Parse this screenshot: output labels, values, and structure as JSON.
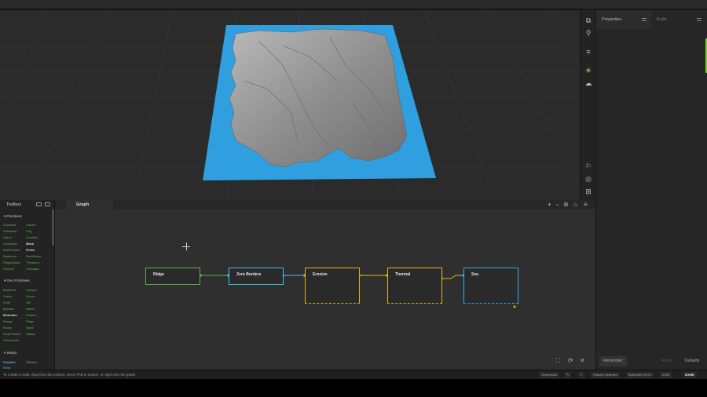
{
  "right_panel": {
    "tabs": [
      {
        "label": "Properties"
      },
      {
        "label": "Build"
      }
    ],
    "footer": {
      "remember": "Remember",
      "reset": "Reset",
      "defaults": "Defaults"
    }
  },
  "toolbox": {
    "title": "Toolbox",
    "sections": [
      {
        "label": "Primitives",
        "items": [
          "Constant",
          "Cracks",
          "DriftNoise",
          "Fog",
          "Gabor",
          "Gradient",
          "LineNoise",
          "Mask",
          "MultiFractal",
          "Perlin",
          "Rasterize",
          "RockNoise",
          "ShapeNoise",
          "Thelepics",
          "Voronoi",
          "Vorowarp"
        ]
      },
      {
        "label": "Geo Primitives",
        "items": [
          "Badlands",
          "Canyon",
          "Crater",
          "Dunes",
          "Fault",
          "Hill",
          "Igneous",
          "Island",
          "Mountain",
          "Plateau",
          "Range",
          "Ridge",
          "Rocks",
          "Sand",
          "SlopeWaves",
          "Stamp",
          "Shorelands"
        ]
      },
      {
        "label": "Warps",
        "items": [
          "Displace",
          "Offwarp",
          "Warp"
        ]
      }
    ]
  },
  "graph": {
    "tab_label": "Graph",
    "nodes": [
      {
        "label": "Ridge",
        "accent": "#5fb04c"
      },
      {
        "label": "Zero Borders",
        "accent": "#3ec3e4"
      },
      {
        "label": "Erosion",
        "accent": "#e3b320"
      },
      {
        "label": "Thermal",
        "accent": "#e3b320"
      },
      {
        "label": "Sea",
        "accent": "#2eafe8"
      }
    ]
  },
  "status": {
    "hint": "To create a node, drag from the toolbox, press TAB to search, or right-click the graph",
    "buttons": {
      "screenshot": "Screenshot",
      "passive_optimize": "Passive Optimize",
      "build_time": "Build time 00:00",
      "resolution": "2048",
      "memory": "8GMB"
    }
  },
  "colors": {
    "water": "#2f9fe0",
    "terrain": "#9a9a9a",
    "accent_green": "#8ac63a"
  }
}
